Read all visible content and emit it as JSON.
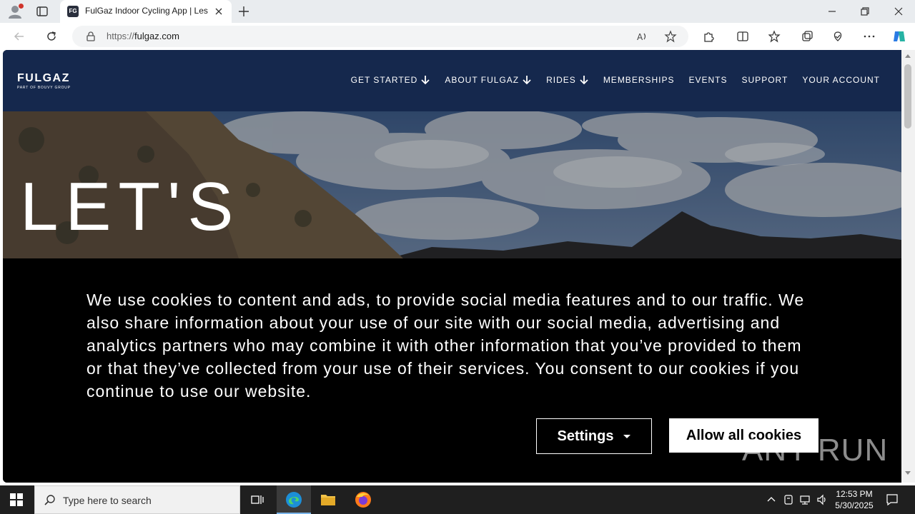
{
  "browser": {
    "tab": {
      "title": "FulGaz Indoor Cycling App | Less",
      "favicon": "FG"
    },
    "address_bar": {
      "protocol": "https://",
      "host": "fulgaz.com"
    }
  },
  "site": {
    "logo": {
      "name": "FULGAZ",
      "tagline": "PART OF BOUVY GROUP"
    },
    "nav": [
      {
        "label": "GET STARTED",
        "dropdown": true
      },
      {
        "label": "ABOUT FULGAZ",
        "dropdown": true
      },
      {
        "label": "RIDES",
        "dropdown": true
      },
      {
        "label": "MEMBERSHIPS",
        "dropdown": false
      },
      {
        "label": "EVENTS",
        "dropdown": false
      },
      {
        "label": "SUPPORT",
        "dropdown": false
      },
      {
        "label": "YOUR ACCOUNT",
        "dropdown": false
      }
    ],
    "hero": {
      "title": "LET'S"
    },
    "colors": {
      "header_bg": "#15284d",
      "cookie_bg": "#000000"
    }
  },
  "cookie_banner": {
    "message": "We use cookies to content and ads, to provide social media features and to our traffic. We also share information about your use of our site with our social media, advertising and analytics partners who may combine it with other information that you’ve provided to them or that they’ve collected from your use of their services. You consent to our cookies if you continue to use our website.",
    "settings_label": "Settings",
    "allow_label": "Allow all cookies"
  },
  "watermark": "ANY RUN",
  "taskbar": {
    "search_placeholder": "Type here to search",
    "time": "12:53 PM",
    "date": "5/30/2025"
  }
}
